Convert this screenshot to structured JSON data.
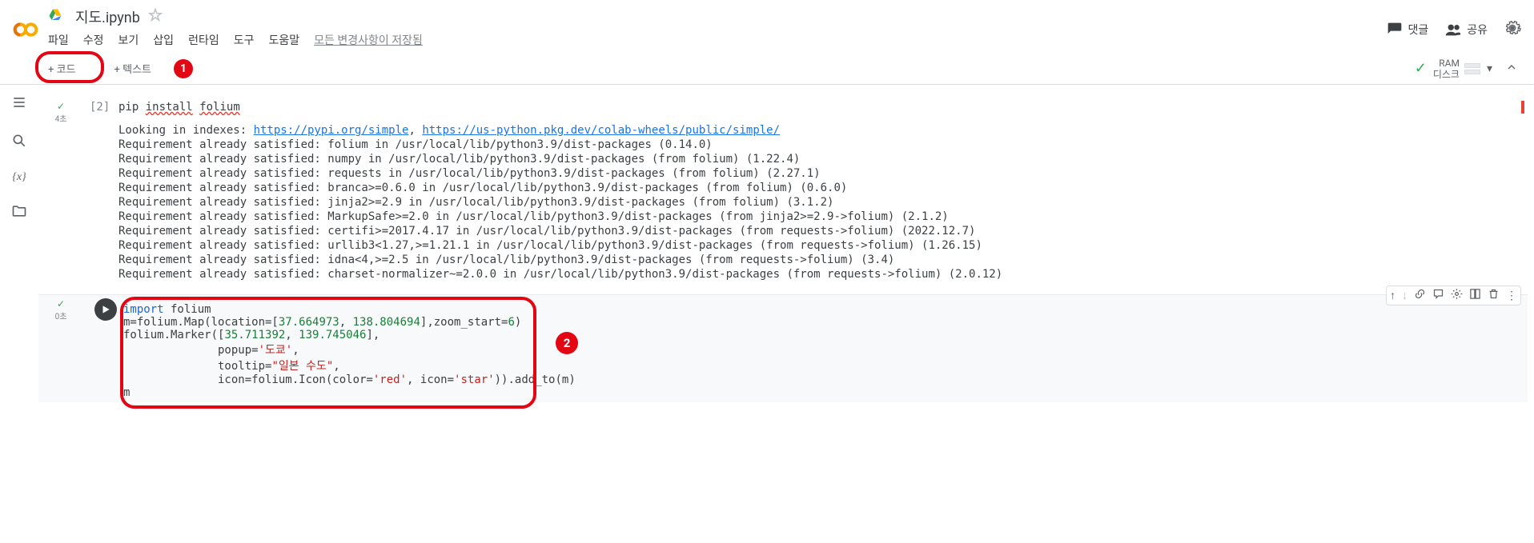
{
  "header": {
    "title": "지도.ipynb",
    "menus": [
      "파일",
      "수정",
      "보기",
      "삽입",
      "런타임",
      "도구",
      "도움말"
    ],
    "save_status": "모든 변경사항이 저장됨",
    "comment": "댓글",
    "share": "공유"
  },
  "toolbar": {
    "add_code": "+ 코드",
    "add_text": "+ 텍스트",
    "ram": "RAM",
    "disk": "디스크"
  },
  "annotations": {
    "badge1": "1",
    "badge2": "2"
  },
  "cell1": {
    "exec_count": "[2]",
    "gutter_time": "4초",
    "code_parts": {
      "p1": "pip ",
      "p2": "install",
      "p3": " ",
      "p4": "folium"
    },
    "output": {
      "line1_pre": "Looking in indexes: ",
      "link1": "https://pypi.org/simple",
      "sep": ", ",
      "link2": "https://us-python.pkg.dev/colab-wheels/public/simple/",
      "lines": [
        "Requirement already satisfied: folium in /usr/local/lib/python3.9/dist-packages (0.14.0)",
        "Requirement already satisfied: numpy in /usr/local/lib/python3.9/dist-packages (from folium) (1.22.4)",
        "Requirement already satisfied: requests in /usr/local/lib/python3.9/dist-packages (from folium) (2.27.1)",
        "Requirement already satisfied: branca>=0.6.0 in /usr/local/lib/python3.9/dist-packages (from folium) (0.6.0)",
        "Requirement already satisfied: jinja2>=2.9 in /usr/local/lib/python3.9/dist-packages (from folium) (3.1.2)",
        "Requirement already satisfied: MarkupSafe>=2.0 in /usr/local/lib/python3.9/dist-packages (from jinja2>=2.9->folium) (2.1.2)",
        "Requirement already satisfied: certifi>=2017.4.17 in /usr/local/lib/python3.9/dist-packages (from requests->folium) (2022.12.7)",
        "Requirement already satisfied: urllib3<1.27,>=1.21.1 in /usr/local/lib/python3.9/dist-packages (from requests->folium) (1.26.15)",
        "Requirement already satisfied: idna<4,>=2.5 in /usr/local/lib/python3.9/dist-packages (from requests->folium) (3.4)",
        "Requirement already satisfied: charset-normalizer~=2.0.0 in /usr/local/lib/python3.9/dist-packages (from requests->folium) (2.0.12)"
      ]
    }
  },
  "cell2": {
    "gutter_time": "0초",
    "code": {
      "l1": {
        "a": "import",
        "b": " folium"
      },
      "l2": {
        "a": "m=folium.Map(location=[",
        "b": "37.664973",
        "c": ", ",
        "d": "138.804694",
        "e": "],zoom_start=",
        "f": "6",
        "g": ")"
      },
      "l3": {
        "a": "folium.Marker([",
        "b": "35.711392",
        "c": ", ",
        "d": "139.745046",
        "e": "],"
      },
      "l4": {
        "a": "              popup=",
        "b": "'도쿄'",
        "c": ","
      },
      "l5": {
        "a": "              tooltip=",
        "b": "\"일본 수도\"",
        "c": ","
      },
      "l6": {
        "a": "              icon=folium.Icon(color=",
        "b": "'red'",
        "c": ", icon=",
        "d": "'star'",
        "e": ")).add_to(m)"
      },
      "l7": "m"
    }
  }
}
